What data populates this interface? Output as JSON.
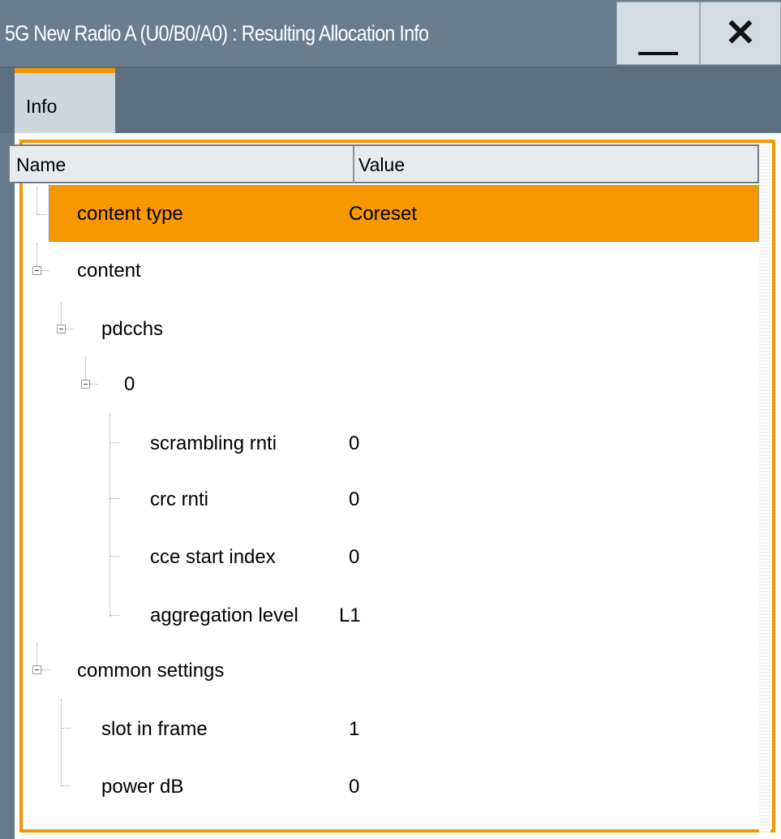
{
  "window": {
    "title": "5G New Radio A (U0/B0/A0) : Resulting Allocation Info",
    "close_glyph": "✕"
  },
  "tabs": [
    {
      "label": "Info",
      "active": true
    }
  ],
  "table": {
    "columns": [
      "Name",
      "Value"
    ],
    "rows": [
      {
        "name": "content type",
        "value": "Coreset",
        "level": 0,
        "selected": true
      },
      {
        "name": "content",
        "value": "",
        "level": 0,
        "expanded": true
      },
      {
        "name": "pdcchs",
        "value": "",
        "level": 1,
        "expanded": true
      },
      {
        "name": "0",
        "value": "",
        "level": 2,
        "expanded": true
      },
      {
        "name": "scrambling rnti",
        "value": "0",
        "level": 3
      },
      {
        "name": "crc rnti",
        "value": "0",
        "level": 3
      },
      {
        "name": "cce start index",
        "value": "0",
        "level": 3
      },
      {
        "name": "aggregation level",
        "value": "L1",
        "level": 3
      },
      {
        "name": "common settings",
        "value": "",
        "level": 0,
        "expanded": true
      },
      {
        "name": "slot in frame",
        "value": "1",
        "level": 1
      },
      {
        "name": "power dB",
        "value": "0",
        "level": 1
      }
    ]
  },
  "colors": {
    "accent": "#f39700",
    "titlebar": "#6a7d8e",
    "tab_active": "#ccd6de"
  }
}
